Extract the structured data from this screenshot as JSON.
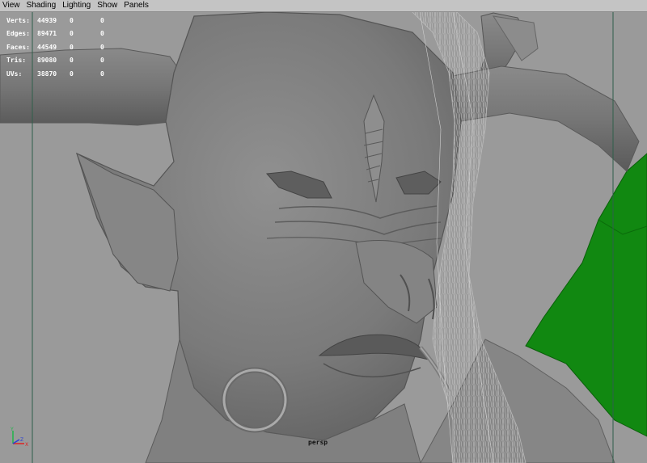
{
  "menu": [
    "View",
    "Shading",
    "Lighting",
    "Show",
    "Panels"
  ],
  "hud": [
    {
      "label": "Verts:",
      "v1": "44939",
      "v2": "0",
      "v3": "0"
    },
    {
      "label": "Edges:",
      "v1": "89471",
      "v2": "0",
      "v3": "0"
    },
    {
      "label": "Faces:",
      "v1": "44549",
      "v2": "0",
      "v3": "0"
    },
    {
      "label": "Tris:",
      "v1": "89080",
      "v2": "0",
      "v3": "0"
    },
    {
      "label": "UVs:",
      "v1": "38870",
      "v2": "0",
      "v3": "0"
    }
  ],
  "camera": "persp",
  "axis": {
    "y": "Y",
    "x": "X",
    "z": "Z"
  },
  "colors": {
    "viewport_bg": "#9a9a9a",
    "model": "#7d7d7d",
    "green_object": "#118811",
    "menubar": "#c4c4c4",
    "gate_line": "#2f5f4a"
  }
}
